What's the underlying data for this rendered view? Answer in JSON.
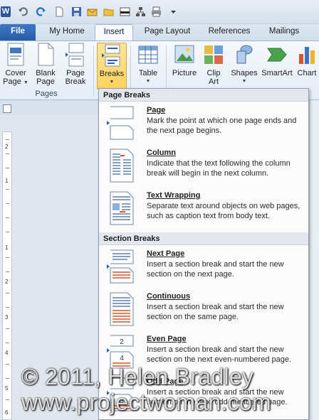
{
  "tabs": {
    "file": "File",
    "my_home": "My Home",
    "insert": "Insert",
    "page_layout": "Page Layout",
    "references": "References",
    "mailings": "Mailings"
  },
  "ribbon": {
    "cover_page": [
      "Cover",
      "Page"
    ],
    "blank_page": [
      "Blank",
      "Page"
    ],
    "page_break": [
      "Page",
      "Break"
    ],
    "breaks": "Breaks",
    "table": "Table",
    "picture": "Picture",
    "clip_art": [
      "Clip",
      "Art"
    ],
    "shapes": "Shapes",
    "smartart": "SmartArt",
    "chart": "Chart",
    "pages_group_label": "Pages"
  },
  "ruler": {
    "numbers": [
      "2",
      "1",
      "1",
      "2",
      "3",
      "4",
      "5",
      "6"
    ]
  },
  "menu": {
    "page_breaks_header": "Page Breaks",
    "section_breaks_header": "Section Breaks",
    "items": [
      {
        "title": "Page",
        "desc": "Mark the point at which one page ends and the next page begins."
      },
      {
        "title": "Column",
        "desc": "Indicate that the text following the column break will begin in the next column."
      },
      {
        "title": "Text Wrapping",
        "desc": "Separate text around objects on web pages, such as caption text from body text."
      },
      {
        "title": "Next Page",
        "desc": "Insert a section break and start the new section on the next page."
      },
      {
        "title": "Continuous",
        "desc": "Insert a section break and start the new section on the same page."
      },
      {
        "title": "Even Page",
        "desc": "Insert a section break and start the new section on the next even-numbered page."
      },
      {
        "title": "Odd Page",
        "desc": "Insert a section break and start the new section on the next odd-numbered page."
      }
    ]
  },
  "watermark": {
    "line1": "© 2011, Helen Bradley",
    "line2": "www.projectwoman.com"
  },
  "colors": {
    "accent": "#2b579a",
    "breaks_highlight": "#ffd35e",
    "break_marker": "#d9542b"
  }
}
